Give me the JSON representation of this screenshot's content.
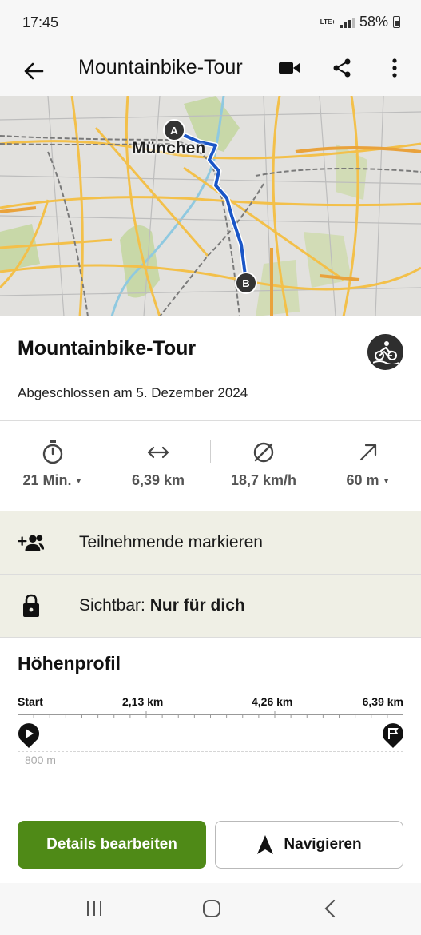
{
  "status_bar": {
    "time": "17:45",
    "network": "LTE+",
    "battery": "58%"
  },
  "app_bar": {
    "title": "Mountainbike-Tour"
  },
  "map": {
    "city_label": "München",
    "start_marker": "A",
    "end_marker": "B",
    "route_color": "#1a56c7"
  },
  "tour": {
    "title": "Mountainbike-Tour",
    "completed": "Abgeschlossen am 5. Dezember 2024",
    "sport_icon": "mountain-bike-icon"
  },
  "stats": [
    {
      "icon": "stopwatch-icon",
      "value": "21 Min.",
      "dropdown": true
    },
    {
      "icon": "distance-icon",
      "value": "6,39 km",
      "dropdown": false
    },
    {
      "icon": "average-speed-icon",
      "value": "18,7 km/h",
      "dropdown": false
    },
    {
      "icon": "ascent-icon",
      "value": "60 m",
      "dropdown": true
    }
  ],
  "actions": {
    "tag_participants": "Teilnehmende markieren",
    "visibility_prefix": "Sichtbar: ",
    "visibility_value": "Nur für dich"
  },
  "elevation": {
    "title": "Höhenprofil",
    "ticks": [
      "Start",
      "2,13 km",
      "4,26 km",
      "6,39 km"
    ],
    "y_label": "800 m"
  },
  "buttons": {
    "edit": "Details bearbeiten",
    "navigate": "Navigieren"
  },
  "colors": {
    "accent_green": "#4f8a17",
    "row_bg": "#efefe5"
  }
}
